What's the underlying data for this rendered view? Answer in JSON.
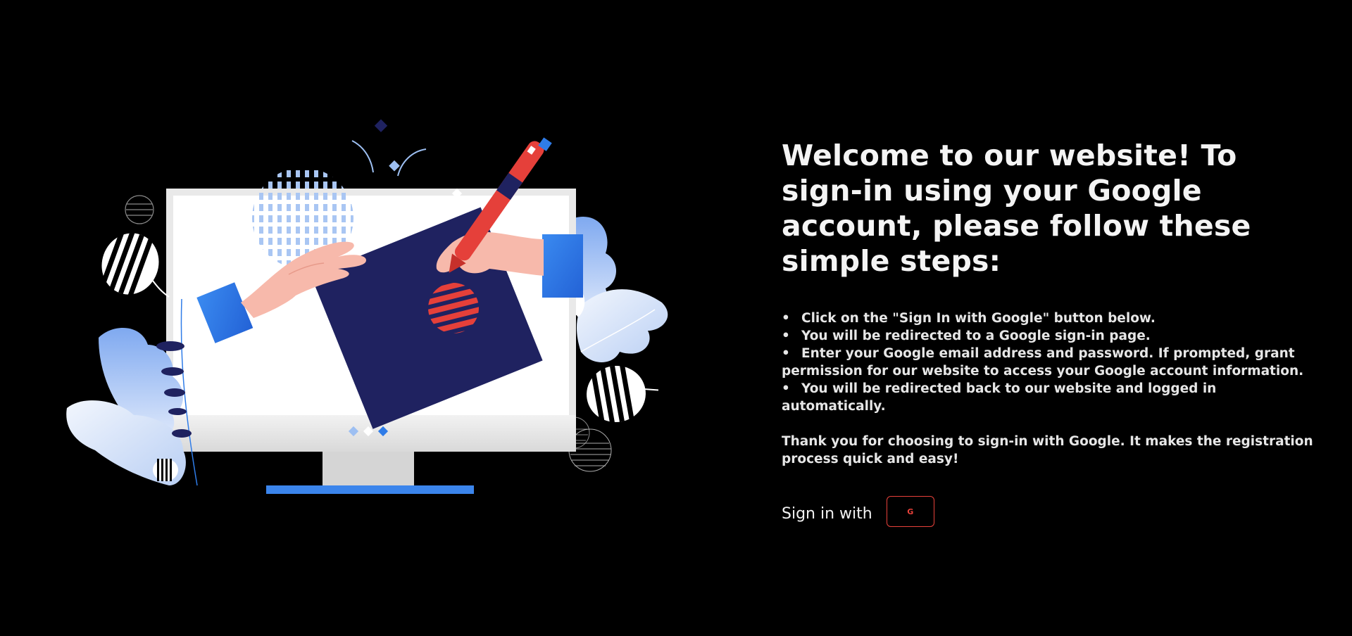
{
  "welcome": {
    "title": "Welcome to our website! To sign-in using your Google account, please follow these simple steps:",
    "steps": [
      "Click on the \"Sign In with Google\" button below.",
      "You will be redirected to a Google sign-in page.",
      "Enter your Google email address and password. If prompted, grant permission for our website to access your Google account information.",
      "You will be redirected back to our website and logged in automatically."
    ],
    "thanks": "Thank you for choosing to sign-in with Google. It makes the registration process quick and easy!"
  },
  "signin": {
    "label": "Sign in with",
    "button_icon": "google-icon",
    "button_text": "G",
    "accent_color": "#e8413a"
  },
  "illustration": {
    "icon": "computer-drawing-illustration",
    "colors": {
      "navy": "#1f2260",
      "blue": "#2f7ce8",
      "light_blue": "#9dbff2",
      "red": "#e5403a",
      "skin": "#f7b9ab"
    }
  }
}
